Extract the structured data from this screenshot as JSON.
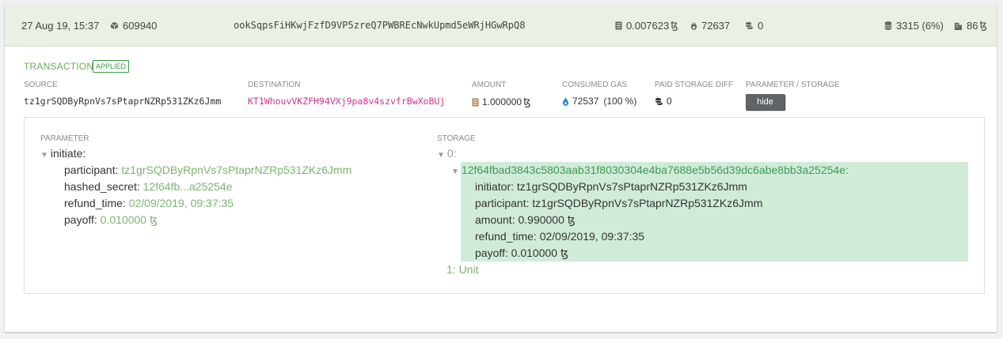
{
  "header": {
    "datetime": "27 Aug 19, 15:37",
    "block": "609940",
    "op_hash": "ookSqpsFiHKwjFzfD9VP5zreQ7PWBREcNwkUpmd5eWRjHGwRpQ8",
    "fee": "0.007623",
    "gas": "72637",
    "burned": "0",
    "storage": "3315 (6%)",
    "storage_cost": "86"
  },
  "currency_symbol": "ꜩ",
  "transaction": {
    "title": "TRANSACTION",
    "status": "APPLIED",
    "labels": {
      "source": "SOURCE",
      "destination": "DESTINATION",
      "amount": "AMOUNT",
      "consumed_gas": "CONSUMED GAS",
      "paid_storage_diff": "PAID STORAGE DIFF",
      "param_storage": "PARAMETER / STORAGE"
    },
    "source": "tz1grSQDByRpnVs7sPtaprNZRp531ZKz6Jmm",
    "destination": "KT1WhouvVKZFH94VXj9pa8v4szvfrBwXoBUj",
    "amount": "1.000000",
    "consumed_gas": "72537",
    "consumed_gas_pct": "(100 %)",
    "paid_storage_diff": "0",
    "hide_button": "hide"
  },
  "parameter": {
    "label": "PARAMETER",
    "root": "initiate:",
    "fields": [
      {
        "key": "participant:",
        "value": "tz1grSQDByRpnVs7sPtaprNZRp531ZKz6Jmm"
      },
      {
        "key": "hashed_secret:",
        "value": "12f64fb...a25254e"
      },
      {
        "key": "refund_time:",
        "value": "02/09/2019, 09:37:35"
      },
      {
        "key": "payoff:",
        "value": "0.010000"
      }
    ]
  },
  "storage": {
    "label": "STORAGE",
    "root": "0:",
    "entry_key": "12f64fbad3843c5803aab31f8030304e4ba7688e5b56d39dc6abe8bb3a25254e:",
    "fields": [
      {
        "key": "initiator:",
        "value": "tz1grSQDByRpnVs7sPtaprNZRp531ZKz6Jmm"
      },
      {
        "key": "participant:",
        "value": "tz1grSQDByRpnVs7sPtaprNZRp531ZKz6Jmm"
      },
      {
        "key": "amount:",
        "value": "0.990000"
      },
      {
        "key": "refund_time:",
        "value": "02/09/2019, 09:37:35"
      },
      {
        "key": "payoff:",
        "value": "0.010000"
      }
    ],
    "second": "1: Unit"
  },
  "colors": {
    "header_bg": "#e8f1e3",
    "accent_green": "#7cb472",
    "highlight_bg": "#d0ecd9",
    "destination_pink": "#d6338c",
    "gas_blue": "#1b8ad4"
  }
}
